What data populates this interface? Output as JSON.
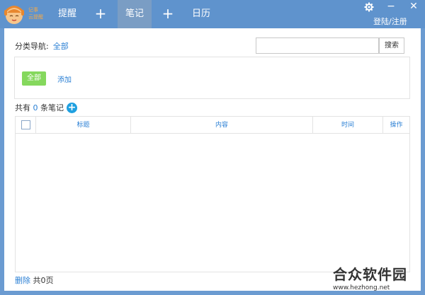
{
  "app": {
    "logo_text": [
      "记事",
      "云提醒"
    ]
  },
  "nav": {
    "tabs": [
      {
        "label": "提醒"
      },
      {
        "label": "笔记"
      },
      {
        "label": "日历"
      }
    ],
    "plus_symbol": "+"
  },
  "window": {
    "settings_icon": "gear-icon",
    "minimize": "−",
    "close": "✕",
    "login_label": "登陆/注册"
  },
  "category": {
    "label": "分类导航:",
    "current": "全部",
    "all_button": "全部",
    "add_link": "添加"
  },
  "search": {
    "value": "",
    "button_label": "搜索"
  },
  "summary": {
    "prefix": "共有",
    "count": "0",
    "suffix": "条笔记"
  },
  "table": {
    "columns": [
      "标题",
      "内容",
      "时间",
      "操作"
    ],
    "rows": []
  },
  "footer": {
    "delete_label": "删除",
    "pages_label": "共0页"
  },
  "watermark": {
    "title": "合众软件园",
    "url": "www.hezhong.net"
  },
  "colors": {
    "titlebar": "#5f93cd",
    "accent": "#2a7fd4",
    "green": "#85d85d",
    "add_circle": "#1fa0e0"
  }
}
